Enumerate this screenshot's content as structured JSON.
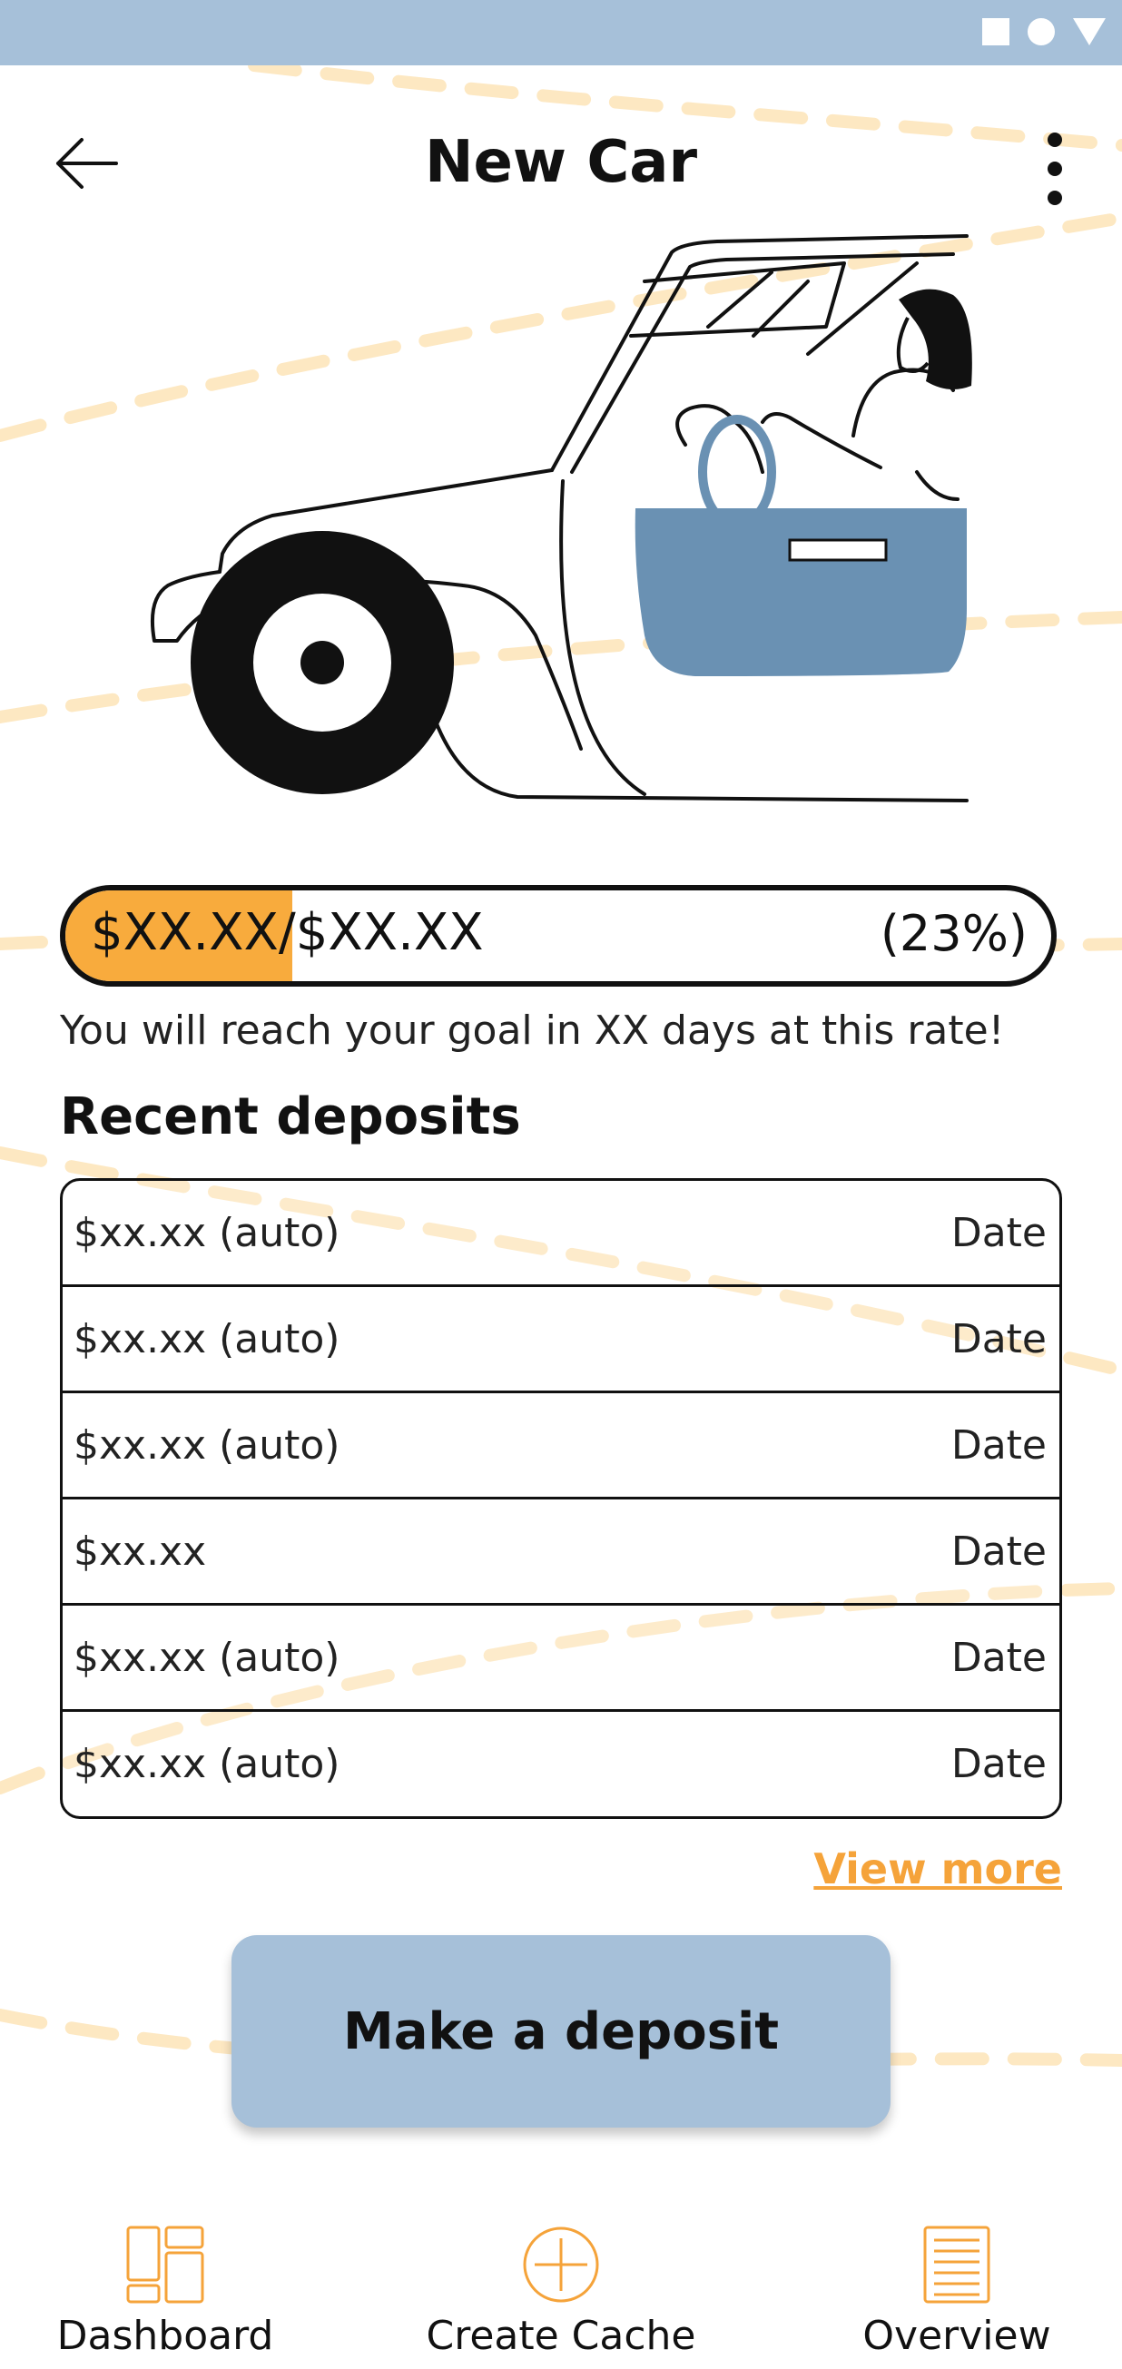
{
  "header": {
    "title": "New Car"
  },
  "progress": {
    "amount_label": "$XX.XX/$XX.XX",
    "percent_label": "(23%)",
    "fraction": 0.23,
    "goal_text": "You will reach your goal in XX days at this rate!"
  },
  "recent": {
    "title": "Recent deposits",
    "rows": [
      {
        "amount": "$xx.xx (auto)",
        "date": "Date"
      },
      {
        "amount": "$xx.xx (auto)",
        "date": "Date"
      },
      {
        "amount": "$xx.xx (auto)",
        "date": "Date"
      },
      {
        "amount": "$xx.xx",
        "date": "Date"
      },
      {
        "amount": "$xx.xx (auto)",
        "date": "Date"
      },
      {
        "amount": "$xx.xx (auto)",
        "date": "Date"
      }
    ],
    "view_more": "View more"
  },
  "actions": {
    "deposit_label": "Make a deposit"
  },
  "nav": {
    "items": [
      {
        "label": "Dashboard",
        "icon": "dashboard-icon"
      },
      {
        "label": "Create Cache",
        "icon": "plus-circle-icon"
      },
      {
        "label": "Overview",
        "icon": "document-icon"
      }
    ]
  },
  "colors": {
    "accent": "#f8ab3d",
    "primary": "#a6c0d9",
    "door_blue": "#6a91b3",
    "decor_dash": "#fde8c2"
  }
}
